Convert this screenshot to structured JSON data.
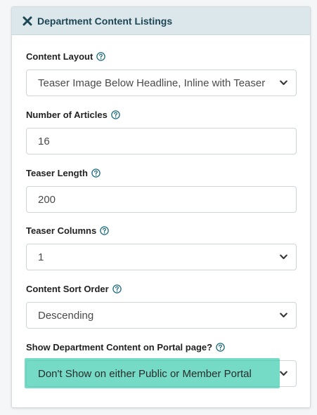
{
  "panel": {
    "title": "Department Content Listings",
    "close_icon": "close-icon"
  },
  "fields": {
    "content_layout": {
      "label": "Content Layout",
      "value": "Teaser Image Below Headline, Inline with Teaser"
    },
    "num_articles": {
      "label": "Number of Articles",
      "value": "16"
    },
    "teaser_length": {
      "label": "Teaser Length",
      "value": "200"
    },
    "teaser_columns": {
      "label": "Teaser Columns",
      "value": "1"
    },
    "sort_order": {
      "label": "Content Sort Order",
      "value": "Descending"
    },
    "portal_page": {
      "label": "Show Department Content on Portal page?",
      "value": "Don't Show on either Public or Member Portal"
    }
  },
  "colors": {
    "header_bg": "#dbe7eb",
    "title": "#1d4654",
    "highlight": "#40cdb0"
  }
}
